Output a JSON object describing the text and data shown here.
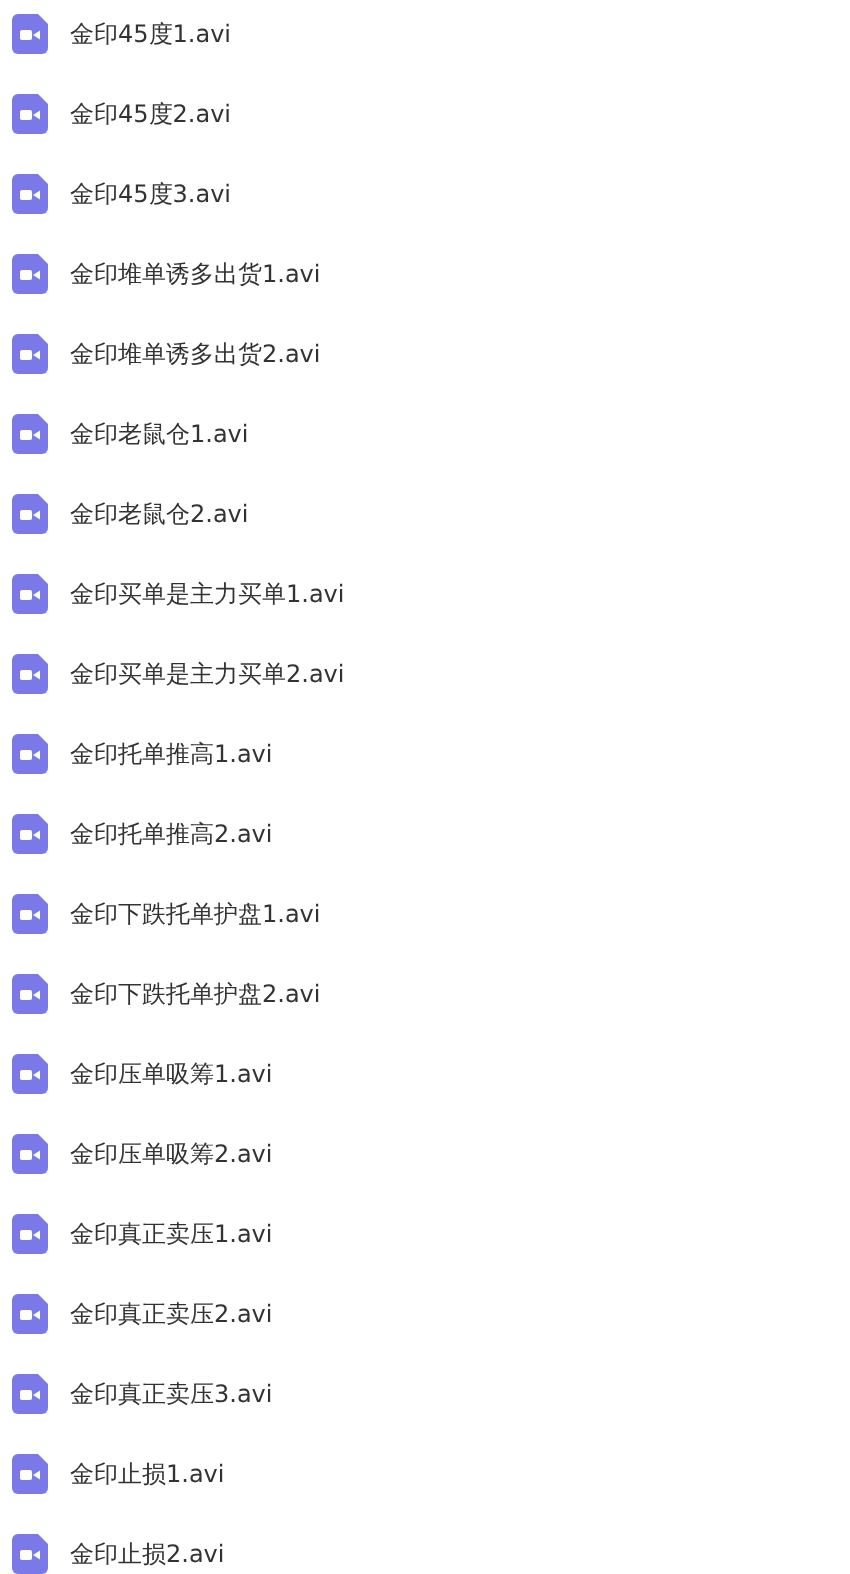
{
  "files": [
    {
      "name": "金印45度1.avi"
    },
    {
      "name": "金印45度2.avi"
    },
    {
      "name": "金印45度3.avi"
    },
    {
      "name": "金印堆单诱多出货1.avi"
    },
    {
      "name": "金印堆单诱多出货2.avi"
    },
    {
      "name": "金印老鼠仓1.avi"
    },
    {
      "name": "金印老鼠仓2.avi"
    },
    {
      "name": "金印买单是主力买单1.avi"
    },
    {
      "name": "金印买单是主力买单2.avi"
    },
    {
      "name": "金印托单推高1.avi"
    },
    {
      "name": "金印托单推高2.avi"
    },
    {
      "name": "金印下跌托单护盘1.avi"
    },
    {
      "name": "金印下跌托单护盘2.avi"
    },
    {
      "name": "金印压单吸筹1.avi"
    },
    {
      "name": "金印压单吸筹2.avi"
    },
    {
      "name": "金印真正卖压1.avi"
    },
    {
      "name": "金印真正卖压2.avi"
    },
    {
      "name": "金印真正卖压3.avi"
    },
    {
      "name": "金印止损1.avi"
    },
    {
      "name": "金印止损2.avi"
    }
  ]
}
